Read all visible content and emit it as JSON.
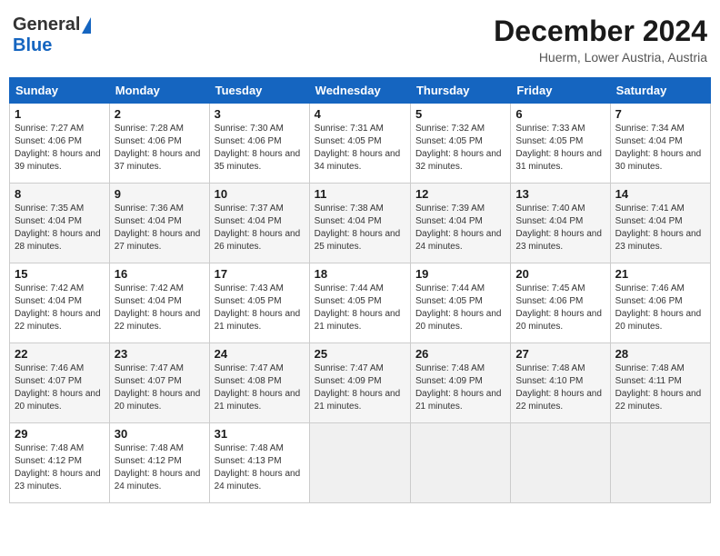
{
  "header": {
    "logo_general": "General",
    "logo_blue": "Blue",
    "month_title": "December 2024",
    "location": "Huerm, Lower Austria, Austria"
  },
  "days_of_week": [
    "Sunday",
    "Monday",
    "Tuesday",
    "Wednesday",
    "Thursday",
    "Friday",
    "Saturday"
  ],
  "weeks": [
    [
      {
        "day": "1",
        "sunrise": "Sunrise: 7:27 AM",
        "sunset": "Sunset: 4:06 PM",
        "daylight": "Daylight: 8 hours and 39 minutes."
      },
      {
        "day": "2",
        "sunrise": "Sunrise: 7:28 AM",
        "sunset": "Sunset: 4:06 PM",
        "daylight": "Daylight: 8 hours and 37 minutes."
      },
      {
        "day": "3",
        "sunrise": "Sunrise: 7:30 AM",
        "sunset": "Sunset: 4:06 PM",
        "daylight": "Daylight: 8 hours and 35 minutes."
      },
      {
        "day": "4",
        "sunrise": "Sunrise: 7:31 AM",
        "sunset": "Sunset: 4:05 PM",
        "daylight": "Daylight: 8 hours and 34 minutes."
      },
      {
        "day": "5",
        "sunrise": "Sunrise: 7:32 AM",
        "sunset": "Sunset: 4:05 PM",
        "daylight": "Daylight: 8 hours and 32 minutes."
      },
      {
        "day": "6",
        "sunrise": "Sunrise: 7:33 AM",
        "sunset": "Sunset: 4:05 PM",
        "daylight": "Daylight: 8 hours and 31 minutes."
      },
      {
        "day": "7",
        "sunrise": "Sunrise: 7:34 AM",
        "sunset": "Sunset: 4:04 PM",
        "daylight": "Daylight: 8 hours and 30 minutes."
      }
    ],
    [
      {
        "day": "8",
        "sunrise": "Sunrise: 7:35 AM",
        "sunset": "Sunset: 4:04 PM",
        "daylight": "Daylight: 8 hours and 28 minutes."
      },
      {
        "day": "9",
        "sunrise": "Sunrise: 7:36 AM",
        "sunset": "Sunset: 4:04 PM",
        "daylight": "Daylight: 8 hours and 27 minutes."
      },
      {
        "day": "10",
        "sunrise": "Sunrise: 7:37 AM",
        "sunset": "Sunset: 4:04 PM",
        "daylight": "Daylight: 8 hours and 26 minutes."
      },
      {
        "day": "11",
        "sunrise": "Sunrise: 7:38 AM",
        "sunset": "Sunset: 4:04 PM",
        "daylight": "Daylight: 8 hours and 25 minutes."
      },
      {
        "day": "12",
        "sunrise": "Sunrise: 7:39 AM",
        "sunset": "Sunset: 4:04 PM",
        "daylight": "Daylight: 8 hours and 24 minutes."
      },
      {
        "day": "13",
        "sunrise": "Sunrise: 7:40 AM",
        "sunset": "Sunset: 4:04 PM",
        "daylight": "Daylight: 8 hours and 23 minutes."
      },
      {
        "day": "14",
        "sunrise": "Sunrise: 7:41 AM",
        "sunset": "Sunset: 4:04 PM",
        "daylight": "Daylight: 8 hours and 23 minutes."
      }
    ],
    [
      {
        "day": "15",
        "sunrise": "Sunrise: 7:42 AM",
        "sunset": "Sunset: 4:04 PM",
        "daylight": "Daylight: 8 hours and 22 minutes."
      },
      {
        "day": "16",
        "sunrise": "Sunrise: 7:42 AM",
        "sunset": "Sunset: 4:04 PM",
        "daylight": "Daylight: 8 hours and 22 minutes."
      },
      {
        "day": "17",
        "sunrise": "Sunrise: 7:43 AM",
        "sunset": "Sunset: 4:05 PM",
        "daylight": "Daylight: 8 hours and 21 minutes."
      },
      {
        "day": "18",
        "sunrise": "Sunrise: 7:44 AM",
        "sunset": "Sunset: 4:05 PM",
        "daylight": "Daylight: 8 hours and 21 minutes."
      },
      {
        "day": "19",
        "sunrise": "Sunrise: 7:44 AM",
        "sunset": "Sunset: 4:05 PM",
        "daylight": "Daylight: 8 hours and 20 minutes."
      },
      {
        "day": "20",
        "sunrise": "Sunrise: 7:45 AM",
        "sunset": "Sunset: 4:06 PM",
        "daylight": "Daylight: 8 hours and 20 minutes."
      },
      {
        "day": "21",
        "sunrise": "Sunrise: 7:46 AM",
        "sunset": "Sunset: 4:06 PM",
        "daylight": "Daylight: 8 hours and 20 minutes."
      }
    ],
    [
      {
        "day": "22",
        "sunrise": "Sunrise: 7:46 AM",
        "sunset": "Sunset: 4:07 PM",
        "daylight": "Daylight: 8 hours and 20 minutes."
      },
      {
        "day": "23",
        "sunrise": "Sunrise: 7:47 AM",
        "sunset": "Sunset: 4:07 PM",
        "daylight": "Daylight: 8 hours and 20 minutes."
      },
      {
        "day": "24",
        "sunrise": "Sunrise: 7:47 AM",
        "sunset": "Sunset: 4:08 PM",
        "daylight": "Daylight: 8 hours and 21 minutes."
      },
      {
        "day": "25",
        "sunrise": "Sunrise: 7:47 AM",
        "sunset": "Sunset: 4:09 PM",
        "daylight": "Daylight: 8 hours and 21 minutes."
      },
      {
        "day": "26",
        "sunrise": "Sunrise: 7:48 AM",
        "sunset": "Sunset: 4:09 PM",
        "daylight": "Daylight: 8 hours and 21 minutes."
      },
      {
        "day": "27",
        "sunrise": "Sunrise: 7:48 AM",
        "sunset": "Sunset: 4:10 PM",
        "daylight": "Daylight: 8 hours and 22 minutes."
      },
      {
        "day": "28",
        "sunrise": "Sunrise: 7:48 AM",
        "sunset": "Sunset: 4:11 PM",
        "daylight": "Daylight: 8 hours and 22 minutes."
      }
    ],
    [
      {
        "day": "29",
        "sunrise": "Sunrise: 7:48 AM",
        "sunset": "Sunset: 4:12 PM",
        "daylight": "Daylight: 8 hours and 23 minutes."
      },
      {
        "day": "30",
        "sunrise": "Sunrise: 7:48 AM",
        "sunset": "Sunset: 4:12 PM",
        "daylight": "Daylight: 8 hours and 24 minutes."
      },
      {
        "day": "31",
        "sunrise": "Sunrise: 7:48 AM",
        "sunset": "Sunset: 4:13 PM",
        "daylight": "Daylight: 8 hours and 24 minutes."
      },
      null,
      null,
      null,
      null
    ]
  ]
}
